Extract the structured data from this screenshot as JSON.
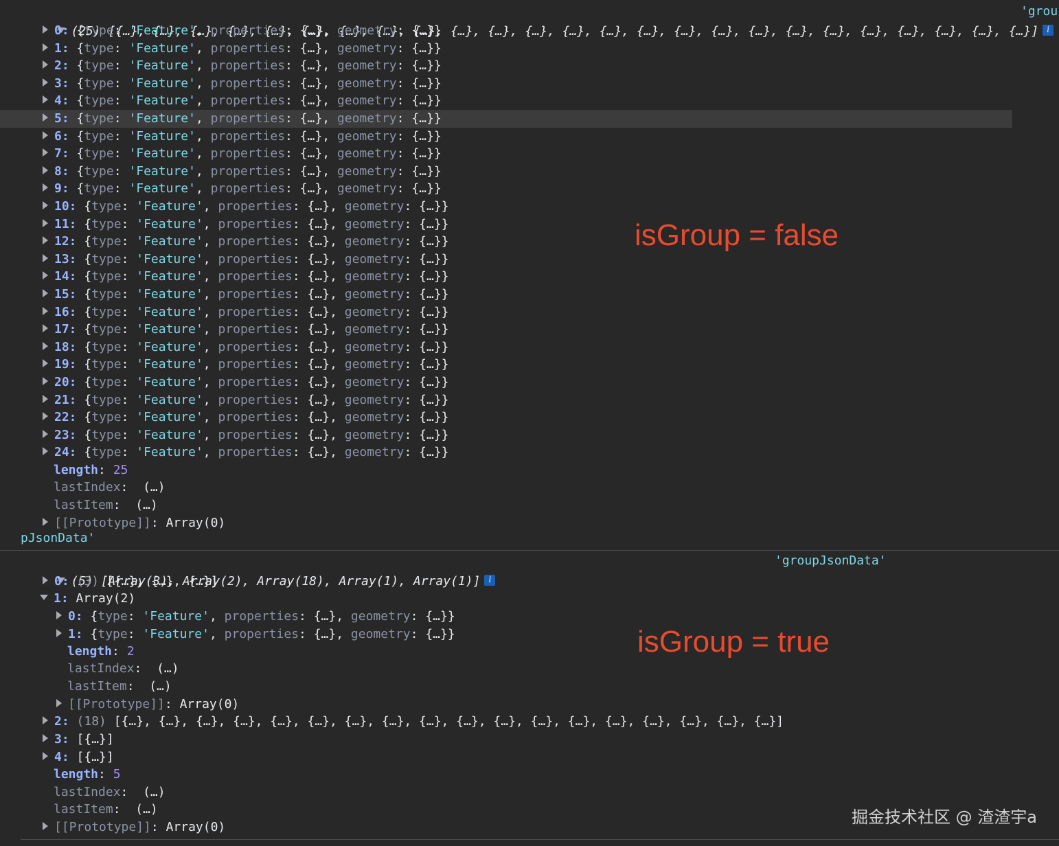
{
  "block1": {
    "summary_count": "(25)",
    "summary_items": "[{…}, {…}, {…}, {…}, {…}, {…}, {…}, {…}, {…}, {…}, {…}, {…}, {…}, {…}, {…}, {…}, {…}, {…}, {…}, {…}, {…}, {…}, {…}, {…}, {…}]",
    "source_label_start": "'grou",
    "source_label_end": "pJsonData'",
    "items": [
      {
        "index": "0:"
      },
      {
        "index": "1:"
      },
      {
        "index": "2:"
      },
      {
        "index": "3:"
      },
      {
        "index": "4:"
      },
      {
        "index": "5:"
      },
      {
        "index": "6:"
      },
      {
        "index": "7:"
      },
      {
        "index": "8:"
      },
      {
        "index": "9:"
      },
      {
        "index": "10:"
      },
      {
        "index": "11:"
      },
      {
        "index": "12:"
      },
      {
        "index": "13:"
      },
      {
        "index": "14:"
      },
      {
        "index": "15:"
      },
      {
        "index": "16:"
      },
      {
        "index": "17:"
      },
      {
        "index": "18:"
      },
      {
        "index": "19:"
      },
      {
        "index": "20:"
      },
      {
        "index": "21:"
      },
      {
        "index": "22:"
      },
      {
        "index": "23:"
      },
      {
        "index": "24:"
      }
    ],
    "length_key": "length",
    "length_value": "25",
    "last_index_key": "lastIndex",
    "last_item_key": "lastItem",
    "collapsed": "(…)",
    "proto_key": "[[Prototype]]",
    "proto_value": "Array(0)"
  },
  "feature": {
    "open": "{",
    "type_key": "type",
    "type_value": "'Feature'",
    "properties_key": "properties",
    "geometry_key": "geometry",
    "obj": "{…}",
    "close": "}"
  },
  "block2": {
    "summary_count": "(5)",
    "summary_items": "[Array(3), Array(2), Array(18), Array(1), Array(1)]",
    "source_label": "'groupJsonData'",
    "item0_index": "0:",
    "item0_count": "(3)",
    "item0_preview": "[{…}, {…}, {…}]",
    "item1_index": "1:",
    "item1_label": "Array(2)",
    "item1_children": [
      {
        "index": "0:"
      },
      {
        "index": "1:"
      }
    ],
    "item1_length_value": "2",
    "item2_index": "2:",
    "item2_count": "(18)",
    "item2_preview": "[{…}, {…}, {…}, {…}, {…}, {…}, {…}, {…}, {…}, {…}, {…}, {…}, {…}, {…}, {…}, {…}, {…}, {…}]",
    "item3_index": "3:",
    "item3_preview": "[{…}]",
    "item4_index": "4:",
    "item4_preview": "[{…}]",
    "length_value": "5"
  },
  "info_glyph": "i",
  "annotations": {
    "false_label": "isGroup = false",
    "true_label": "isGroup = true"
  },
  "watermark": "掘金技术社区 @ 渣渣宇a",
  "colors": {
    "background": "#282828",
    "key": "#9ab4ff",
    "string": "#7fd6e6",
    "number": "#a48cf5",
    "annotation": "#ea4a2e"
  }
}
